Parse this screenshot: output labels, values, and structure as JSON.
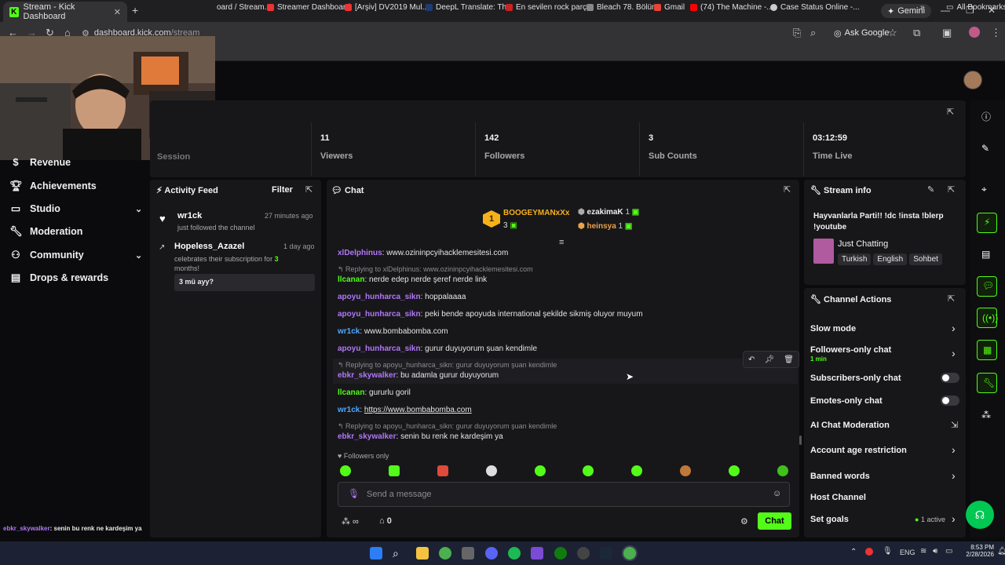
{
  "browser": {
    "tab_title": "Stream - Kick Dashboard",
    "new_tab": "+",
    "gemini": "Gemini",
    "url_host": "dashboard.kick.com",
    "url_path": "/stream",
    "ask_google": "Ask Google",
    "all_bookmarks": "All Bookmarks",
    "bookmarks": [
      "oard / Stream...",
      "Streamer Dashboard",
      "[Arşiv] DV2019 Mul...",
      "DeepL Translate: Th...",
      "En sevilen rock parç...",
      "Bleach 78. Bölüm",
      "Gmail",
      "(74) The Machine -...",
      "Case Status Online -..."
    ]
  },
  "sidebar": {
    "items": [
      {
        "label": "Revenue",
        "icon": "dollar-icon"
      },
      {
        "label": "Achievements",
        "icon": "trophy-icon"
      },
      {
        "label": "Studio",
        "icon": "studio-icon"
      },
      {
        "label": "Moderation",
        "icon": "wrench-icon"
      },
      {
        "label": "Community",
        "icon": "community-icon"
      },
      {
        "label": "Drops & rewards",
        "icon": "gift-icon"
      }
    ],
    "overlay_user": "ebkr_skywalker",
    "overlay_text": ": senin bu renk ne kardeşim ya"
  },
  "stats": {
    "session_label": "Session",
    "items": [
      {
        "value": "11",
        "label": "Viewers"
      },
      {
        "value": "142",
        "label": "Followers"
      },
      {
        "value": "3",
        "label": "Sub Counts"
      },
      {
        "value": "03:12:59",
        "label": "Time Live"
      }
    ]
  },
  "activity": {
    "title": "Activity Feed",
    "filter": "Filter",
    "items": [
      {
        "name": "wr1ck",
        "time": "27 minutes ago",
        "desc": "just followed the channel"
      },
      {
        "name": "Hopeless_Azazel",
        "time": "1 day ago",
        "desc_prefix": "celebrates their subscription for ",
        "months": "3",
        "desc_suffix": " months!",
        "message": "3 mü ayy?"
      }
    ]
  },
  "chat": {
    "title": "Chat",
    "top_gifter": {
      "name": "BOOGEYMANxXx",
      "rank": "1",
      "count": "3"
    },
    "gifters": [
      {
        "name": "ezakimaK",
        "count": "1"
      },
      {
        "name": "heinsya",
        "count": "1"
      }
    ],
    "messages": [
      {
        "user": "xlDelphinus",
        "text": ": www.ozininpcyihacklemesitesi.com",
        "color": "purple"
      },
      {
        "reply": "Replying to xlDelphinus: www.ozininpcyihacklemesitesi.com"
      },
      {
        "user": "llcanan",
        "text": ": nerde edep nerde şeref nerde link",
        "color": "green"
      },
      {
        "user": "apoyu_hunharca_sikn",
        "text": ": hoppalaaaa",
        "color": "purple"
      },
      {
        "user": "apoyu_hunharca_sikn",
        "text": ": peki bende apoyuda international şekilde sikmiş oluyor muyum",
        "color": "purple"
      },
      {
        "user": "wr1ck",
        "text": ": www.bombabomba.com",
        "color": "blue"
      },
      {
        "user": "apoyu_hunharca_sikn",
        "text": ": gurur duyuyorum şuan kendimle",
        "color": "purple"
      },
      {
        "reply": "Replying to apoyu_hunharca_sikn: gurur duyuyorum şuan kendimle"
      },
      {
        "user": "ebkr_skywalker",
        "text": ": bu adamla gurur duyuyorum",
        "color": "purple"
      },
      {
        "user": "llcanan",
        "text": ": gururlu goril",
        "color": "green"
      },
      {
        "user": "wr1ck",
        "text": ": ",
        "link": "https://www.bombabomba.com",
        "color": "blue"
      },
      {
        "reply": "Replying to apoyu_hunharca_sikn: gurur duyuyorum şuan kendimle"
      },
      {
        "user": "ebkr_skywalker",
        "text": ": senin bu renk ne kardeşim ya",
        "color": "purple"
      }
    ],
    "followers_only": "Followers only",
    "input_placeholder": "Send a message",
    "points": "0",
    "send_label": "Chat"
  },
  "stream_info": {
    "title": "Stream info",
    "stream_title": "Hayvanlarla Parti!! !dc !insta !blerp !youtube",
    "category": "Just Chatting",
    "tags": [
      "Turkish",
      "English",
      "Sohbet"
    ]
  },
  "channel_actions": {
    "title": "Channel Actions",
    "slow_mode": "Slow mode",
    "followers_only": "Followers-only chat",
    "followers_only_sub": "1 min",
    "subscribers_only": "Subscribers-only chat",
    "emotes_only": "Emotes-only chat",
    "ai_moderation": "AI Chat Moderation",
    "account_age": "Account age restriction",
    "banned_words": "Banned words",
    "host_channel": "Host Channel",
    "set_goals": "Set goals",
    "goals_status": "1 active"
  },
  "taskbar": {
    "lang": "ENG",
    "time": "8:53 PM",
    "date": "2/28/2026"
  },
  "colors": {
    "accent": "#53fc18",
    "panel": "#17171a",
    "bg": "#0b0b0d"
  }
}
